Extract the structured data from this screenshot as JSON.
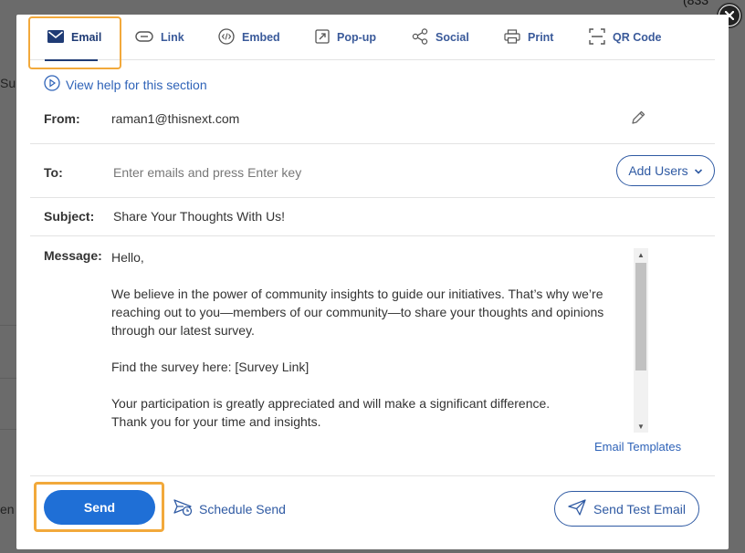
{
  "background": {
    "frag_top_right": "(833",
    "frag_left": "Su",
    "frag_bottom_left": "en"
  },
  "tabs": [
    {
      "label": "Email",
      "icon": "envelope-icon"
    },
    {
      "label": "Link",
      "icon": "link-icon"
    },
    {
      "label": "Embed",
      "icon": "code-icon"
    },
    {
      "label": "Pop-up",
      "icon": "popup-icon"
    },
    {
      "label": "Social",
      "icon": "share-icon"
    },
    {
      "label": "Print",
      "icon": "printer-icon"
    },
    {
      "label": "QR Code",
      "icon": "qr-frame-icon"
    }
  ],
  "help_link": "View help for this section",
  "from": {
    "label": "From:",
    "value": "raman1@thisnext.com"
  },
  "to": {
    "label": "To:",
    "placeholder": "Enter emails and press Enter key",
    "add_users_label": "Add Users"
  },
  "subject": {
    "label": "Subject:",
    "value": "Share Your Thoughts With Us!"
  },
  "message": {
    "label": "Message:",
    "paragraphs": [
      "Hello,",
      "We believe in the power of community insights to guide our initiatives. That’s why we’re reaching out to you—members of our community—to share your thoughts and opinions through our latest survey.",
      "Find the survey here: [Survey Link]",
      "Your participation is greatly appreciated and will make a significant difference.",
      "Thank you for your time and insights."
    ]
  },
  "email_templates_link": "Email Templates",
  "actions": {
    "send_label": "Send",
    "schedule_label": "Schedule Send",
    "test_label": "Send Test Email"
  },
  "colors": {
    "accent": "#1f6fd6",
    "link": "#2f63b8",
    "highlight": "#f2a93b"
  }
}
